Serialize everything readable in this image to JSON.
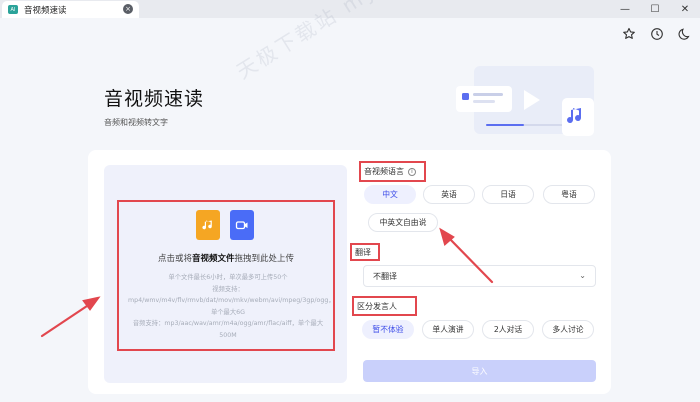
{
  "window": {
    "tab_title": "音视频速读",
    "tab_logo": "AI",
    "minimize": "—",
    "maximize": "☐",
    "close": "✕"
  },
  "page": {
    "title": "音视频速读",
    "subtitle": "音频和视频转文字"
  },
  "watermark": "天极下载站 mydown.yesky.com",
  "upload": {
    "prompt_prefix": "点击或将",
    "prompt_bold": "音视频文件",
    "prompt_suffix": "拖拽到此处上传",
    "desc_lines": [
      "单个文件最长6小时，单次最多可上传50个",
      "视频支持：mp4/wmv/m4v/flv/rmvb/dat/mov/mkv/webm/avi/mpeg/3gp/ogg，单个最大6G",
      "音频支持：mp3/aac/wav/amr/m4a/ogg/amr/flac/aiff，单个最大500M"
    ]
  },
  "language": {
    "label": "音视频语言",
    "options": [
      "中文",
      "英语",
      "日语",
      "粤语",
      "中英文自由说"
    ],
    "selected": "中文"
  },
  "translate": {
    "label": "翻译",
    "value": "不翻译"
  },
  "speaker": {
    "label": "区分发言人",
    "options": [
      "暂不体验",
      "单人演讲",
      "2人对话",
      "多人讨论"
    ],
    "selected": "暂不体验"
  },
  "submit_label": "导入",
  "colors": {
    "accent": "#3d4de8",
    "annotation_red": "#e2474e"
  },
  "icons": {
    "favorite": "star-icon",
    "history": "clock-icon",
    "theme": "moon-icon"
  }
}
